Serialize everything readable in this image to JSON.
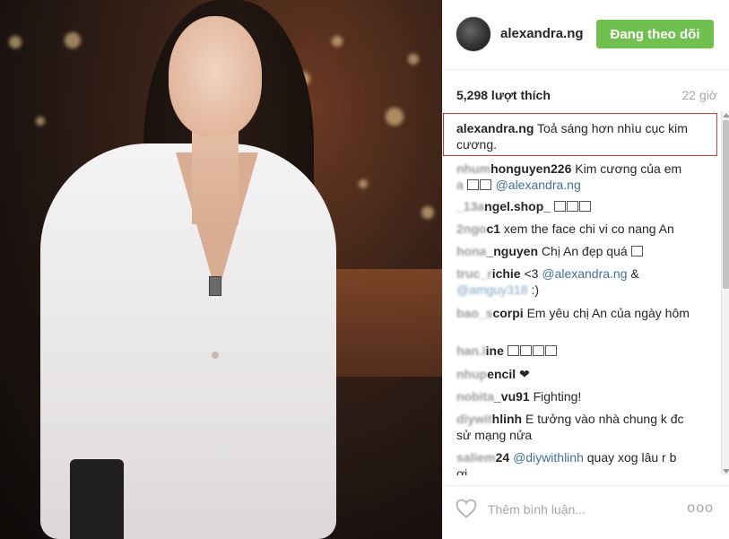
{
  "post": {
    "username": "alexandra.ng",
    "follow_label": "Đang theo dõi",
    "likes": "5,298 lượt thích",
    "time": "22 giờ"
  },
  "caption": {
    "user": "alexandra.ng",
    "text": "Toả sáng hơn nhìu cục kim cương."
  },
  "comments": [
    {
      "user": "nhumhonguyen226",
      "text": "Kim cương của em",
      "line2_prefix": "a",
      "mention": "@alexandra.ng",
      "user_blurred_part": "nhum"
    },
    {
      "user": "_13angel.shop_",
      "text": ""
    },
    {
      "user": "2ngoc1",
      "text": "xem the face chi vi co nang An"
    },
    {
      "user": "hona_nguyen",
      "text": "Chị An đẹp quá"
    },
    {
      "user": "truc_richie",
      "text": "<3",
      "mention": "@alexandra.ng",
      "tail": "&",
      "mention2": "@amguy318",
      "tail2": ":)"
    },
    {
      "user": "bao_scorpi",
      "text": "Em yêu chị An của ngày hôm"
    },
    {
      "user": "han.line",
      "text": ""
    },
    {
      "user": "nhupencil",
      "text": "❤"
    },
    {
      "user": "nobita_vu91",
      "text": "Fighting!"
    },
    {
      "user": "diywithlinh",
      "text": "E tưởng vào nhà chung k đc",
      "line2": "sử mạng nửa"
    },
    {
      "user": "saliem24",
      "text": "",
      "mention": "@diywithlinh",
      "tail": "quay xog lâu r b",
      "line2": "ơi"
    }
  ],
  "footer": {
    "add_comment_placeholder": "Thêm bình luận...",
    "more_label": "ooo"
  },
  "colors": {
    "follow": "#70c050",
    "mention": "#3f729b",
    "highlight": "#d23b3b",
    "muted": "#a5a7aa"
  },
  "icons": [
    "heart-icon",
    "more-options-icon",
    "avatar"
  ]
}
